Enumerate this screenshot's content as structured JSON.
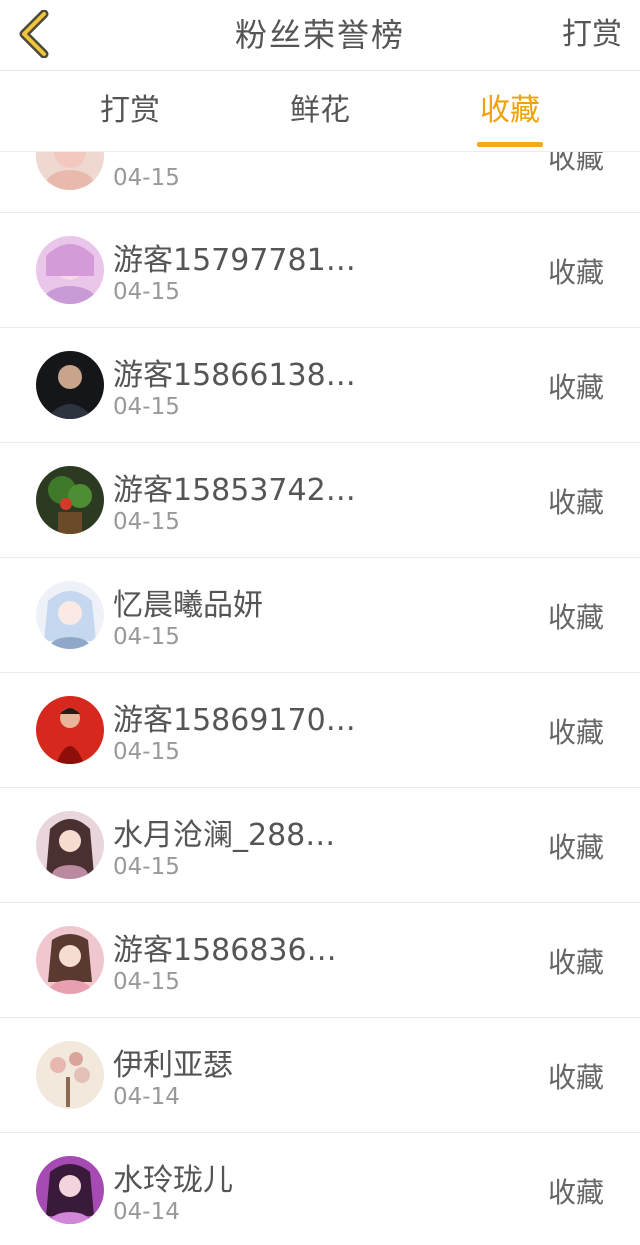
{
  "header": {
    "title": "粉丝荣誉榜",
    "action_label": "打赏"
  },
  "tabs": [
    {
      "label": "打赏"
    },
    {
      "label": "鲜花"
    },
    {
      "label": "收藏"
    }
  ],
  "active_tab": 2,
  "list": [
    {
      "name": "",
      "date": "04-15",
      "action": "收藏"
    },
    {
      "name": "游客15797781…",
      "date": "04-15",
      "action": "收藏"
    },
    {
      "name": "游客15866138…",
      "date": "04-15",
      "action": "收藏"
    },
    {
      "name": "游客15853742…",
      "date": "04-15",
      "action": "收藏"
    },
    {
      "name": "忆晨曦品妍",
      "date": "04-15",
      "action": "收藏"
    },
    {
      "name": "游客15869170…",
      "date": "04-15",
      "action": "收藏"
    },
    {
      "name": "水月沧澜_288…",
      "date": "04-15",
      "action": "收藏"
    },
    {
      "name": "游客1586836…",
      "date": "04-15",
      "action": "收藏"
    },
    {
      "name": "伊利亚瑟",
      "date": "04-14",
      "action": "收藏"
    },
    {
      "name": "水玲珑儿",
      "date": "04-14",
      "action": "收藏"
    }
  ],
  "colors": {
    "accent": "#f5a623",
    "text": "#555555",
    "muted": "#999999"
  }
}
